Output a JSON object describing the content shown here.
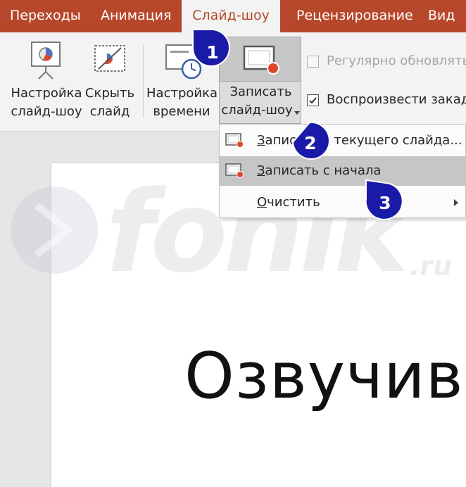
{
  "tabs": [
    {
      "label": "Переходы",
      "active": false
    },
    {
      "label": "Анимация",
      "active": false
    },
    {
      "label": "Слайд-шоу",
      "active": true
    },
    {
      "label": "Рецензирование",
      "active": false
    },
    {
      "label": "Вид",
      "active": false
    }
  ],
  "ribbon": {
    "setup_show": {
      "line1": "Настройка",
      "line2": "слайд-шоу"
    },
    "hide_slide": {
      "line1": "Скрыть",
      "line2": "слайд"
    },
    "rehearse_timings": {
      "line1": "Настройка",
      "line2": "времени"
    },
    "record_show": {
      "line1": "Записать",
      "line2": "слайд-шоу"
    },
    "keep_updated": {
      "label": "Регулярно обновлять с",
      "checked": false
    },
    "play_narrations": {
      "label": "Воспроизвести закадро",
      "checked": true
    }
  },
  "menu": {
    "items": [
      {
        "label": "Записать с текущего слайда...",
        "accel": "З"
      },
      {
        "label": "Записать с начала",
        "accel": "З",
        "highlighted": true
      },
      {
        "label": "Очистить",
        "accel": "О",
        "has_submenu": true
      }
    ]
  },
  "slide": {
    "title": "Озвучив"
  },
  "callouts": [
    "1",
    "2",
    "3"
  ],
  "watermark": {
    "text": "fonik",
    "suffix": ".ru"
  },
  "colors": {
    "accent": "#b7472a",
    "callout": "#1a1aa8",
    "record_red": "#e0452a",
    "highlight": "#c6c6c6"
  }
}
